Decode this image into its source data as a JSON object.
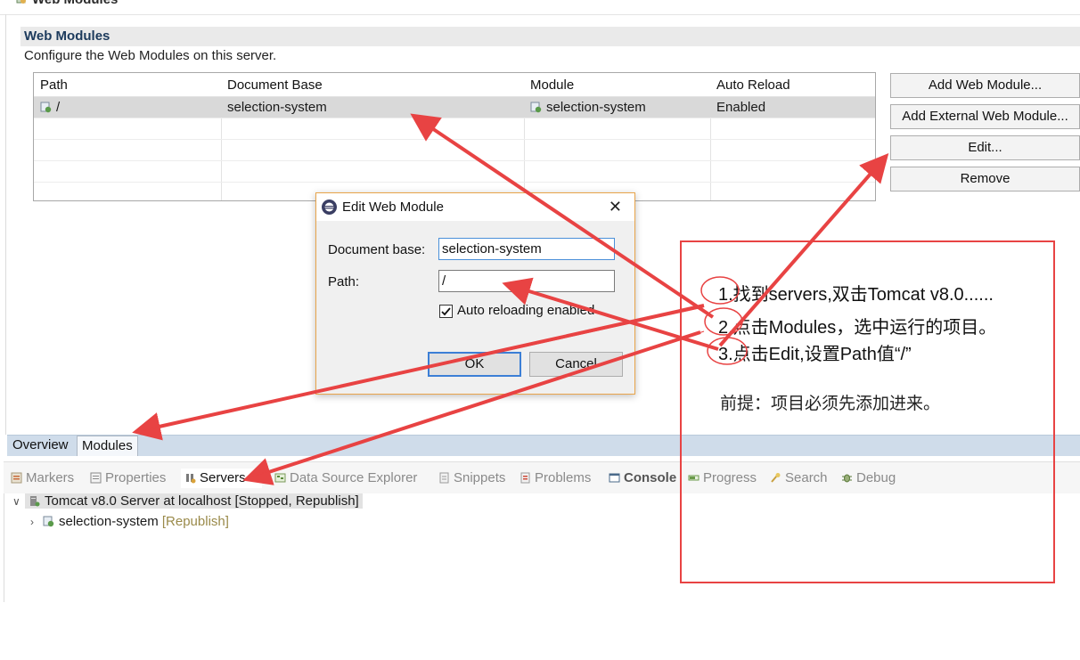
{
  "page": {
    "title": "Web Modules"
  },
  "section": {
    "header": "Web Modules",
    "description": "Configure the Web Modules on this server."
  },
  "table": {
    "columns": [
      "Path",
      "Document Base",
      "Module",
      "Auto Reload"
    ],
    "rows": [
      {
        "path": "/",
        "document_base": "selection-system",
        "module": "selection-system",
        "auto_reload": "Enabled"
      }
    ]
  },
  "buttons": {
    "add_web_module": "Add Web Module...",
    "add_external_web_module": "Add External Web Module...",
    "edit": "Edit...",
    "remove": "Remove"
  },
  "editor_tabs": [
    {
      "label": "Overview"
    },
    {
      "label": "Modules"
    }
  ],
  "views": {
    "markers": "Markers",
    "properties": "Properties",
    "servers": "Servers",
    "data_source_explorer": "Data Source Explorer",
    "snippets": "Snippets",
    "problems": "Problems",
    "console": "Console",
    "progress": "Progress",
    "search": "Search",
    "debug": "Debug"
  },
  "tree": {
    "server": "Tomcat v8.0 Server at localhost",
    "server_status": "[Stopped, Republish]",
    "module": "selection-system",
    "module_status": "[Republish]"
  },
  "dialog": {
    "title": "Edit Web Module",
    "document_base_label": "Document base:",
    "document_base_value": "selection-system",
    "path_label": "Path:",
    "path_value": "/",
    "auto_reload_label": "Auto reloading enabled",
    "auto_reload_checked": true,
    "ok": "OK",
    "cancel": "Cancel"
  },
  "annotation": {
    "step1": "1.找到servers,双击Tomcat v8.0......",
    "step2": "2.点击Modules，选中运行的项目。",
    "step3": "3.点击Edit,设置Path值“/”",
    "premise": "前提：项目必须先添加进来。",
    "color": "#e84343"
  }
}
